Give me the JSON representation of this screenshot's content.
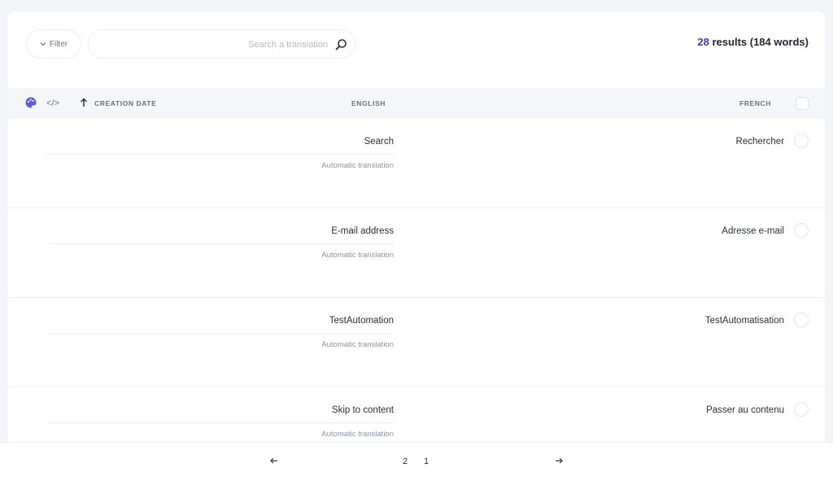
{
  "header": {
    "results_count": "28",
    "results_text": " results (184 words)",
    "search_placeholder": "Search a translation",
    "filter_label": "Filter"
  },
  "columns": {
    "french": "FRENCH",
    "english": "ENGLISH",
    "creation_date": "CREATION DATE",
    "code_symbol": "</>"
  },
  "rows": [
    {
      "source": "Rechercher",
      "target": "Search",
      "note": "Automatic translation"
    },
    {
      "source": "Adresse e-mail",
      "target": "E-mail address",
      "note": "Automatic translation"
    },
    {
      "source": "TestAutomatisation",
      "target": "TestAutomation",
      "note": "Automatic translation"
    },
    {
      "source": "Passer au contenu",
      "target": "Skip to content",
      "note": "Automatic translation"
    }
  ],
  "pagination": {
    "pages": [
      "1",
      "2"
    ]
  },
  "colors": {
    "accent": "#3c3fb4",
    "palette": "#5b5fd6"
  }
}
